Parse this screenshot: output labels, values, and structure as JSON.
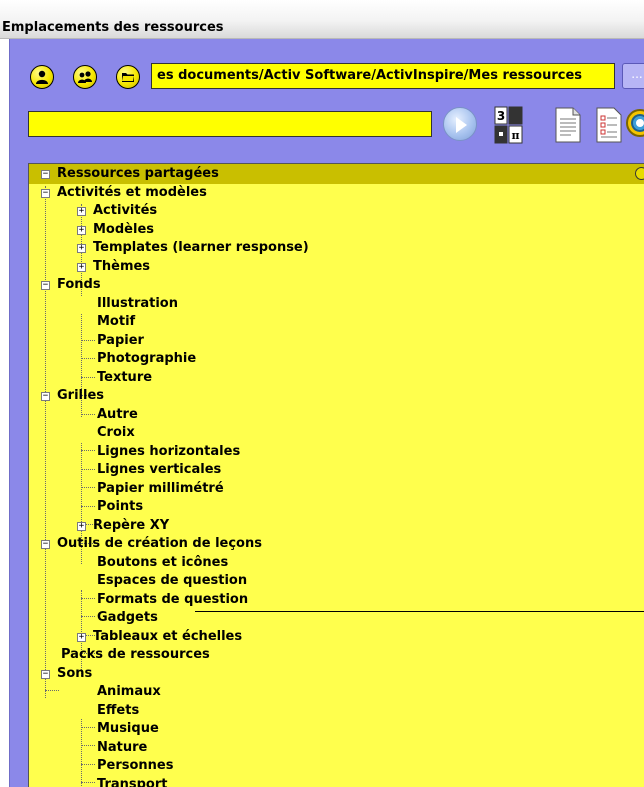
{
  "window": {
    "title": "Emplacements des ressources"
  },
  "toolbar": {
    "icons": [
      "my-resources-icon",
      "shared-resources-icon",
      "folder-icon"
    ],
    "path_value": "es documents/Activ Software/ActivInspire/Mes ressources",
    "browse_label": "...",
    "search_value": "",
    "tool_icons": [
      "go-icon",
      "math-keypad-icon",
      "document-icon",
      "checklist-icon",
      "search-icon"
    ]
  },
  "colors": {
    "panel_bg": "#8b88e9",
    "tree_bg": "#ffff4d",
    "selected_bg": "#c9bf00",
    "input_bg": "#ffff00"
  },
  "tree": {
    "root": "Ressources partagées",
    "items": [
      "Activités et modèles",
      "Activités",
      "Modèles",
      "Templates (learner response)",
      "Thèmes",
      "Fonds",
      "Illustration",
      "Motif",
      "Papier",
      "Photographie",
      "Texture",
      "Grilles",
      "Autre",
      "Croix",
      "Lignes horizontales",
      "Lignes verticales",
      "Papier millimétré",
      "Points",
      "Repère XY",
      "Outils de création de leçons",
      "Boutons et icônes",
      "Espaces de question",
      "Formats de question",
      "Gadgets",
      "Tableaux et échelles",
      "Packs de ressources",
      "Sons",
      "Animaux",
      "Effets",
      "Musique",
      "Nature",
      "Personnes",
      "Transport"
    ]
  }
}
